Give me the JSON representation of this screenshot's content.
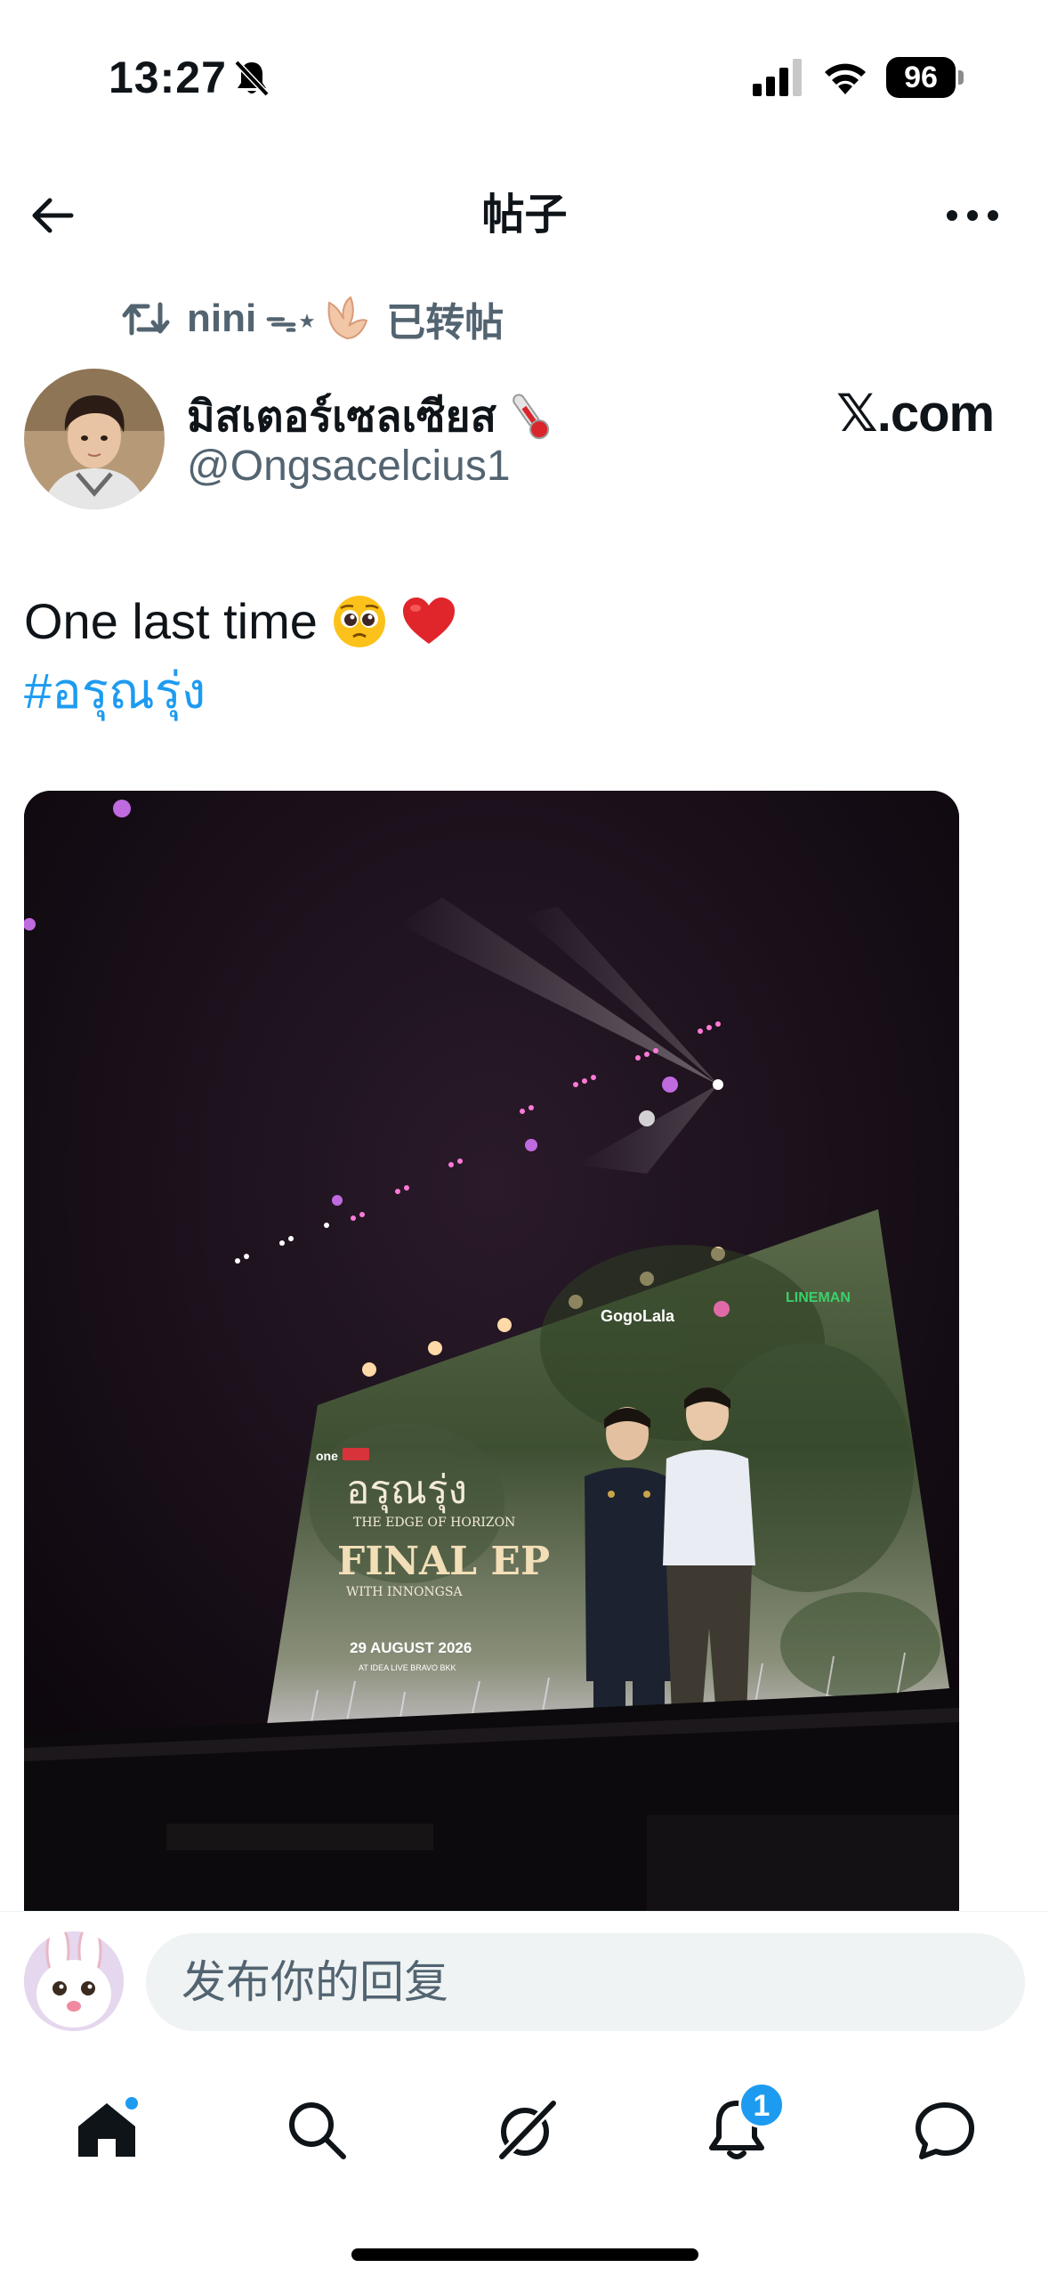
{
  "status_bar": {
    "time": "13:27",
    "battery": "96"
  },
  "nav": {
    "title": "帖子"
  },
  "repost": {
    "user": "nini",
    "decor": "ᯓ⋆",
    "label": "已转帖"
  },
  "author": {
    "name": "มิสเตอร์เซลเซียส",
    "handle": "@Ongsacelcius1",
    "watermark": "𝕏.com"
  },
  "post": {
    "text": "One last time",
    "hashtag": "#อรุณรุ่ง"
  },
  "media_screen": {
    "title_thai": "อรุณรุ่ง",
    "subtitle": "THE EDGE OF HORIZON",
    "final": "FINAL EP",
    "with": "WITH INNONGSA",
    "date": "29 AUGUST 2026",
    "venue": "AT IDEA LIVE BRAVO BKK",
    "sponsor1": "GogoLala",
    "sponsor2": "LINEMAN",
    "sponsor3": "one"
  },
  "reply": {
    "placeholder": "发布你的回复"
  },
  "tabs": {
    "notifications_count": "1"
  },
  "colors": {
    "accent": "#1d9bf0",
    "text": "#0f1419",
    "muted": "#536471",
    "input_bg": "#eff3f4"
  }
}
